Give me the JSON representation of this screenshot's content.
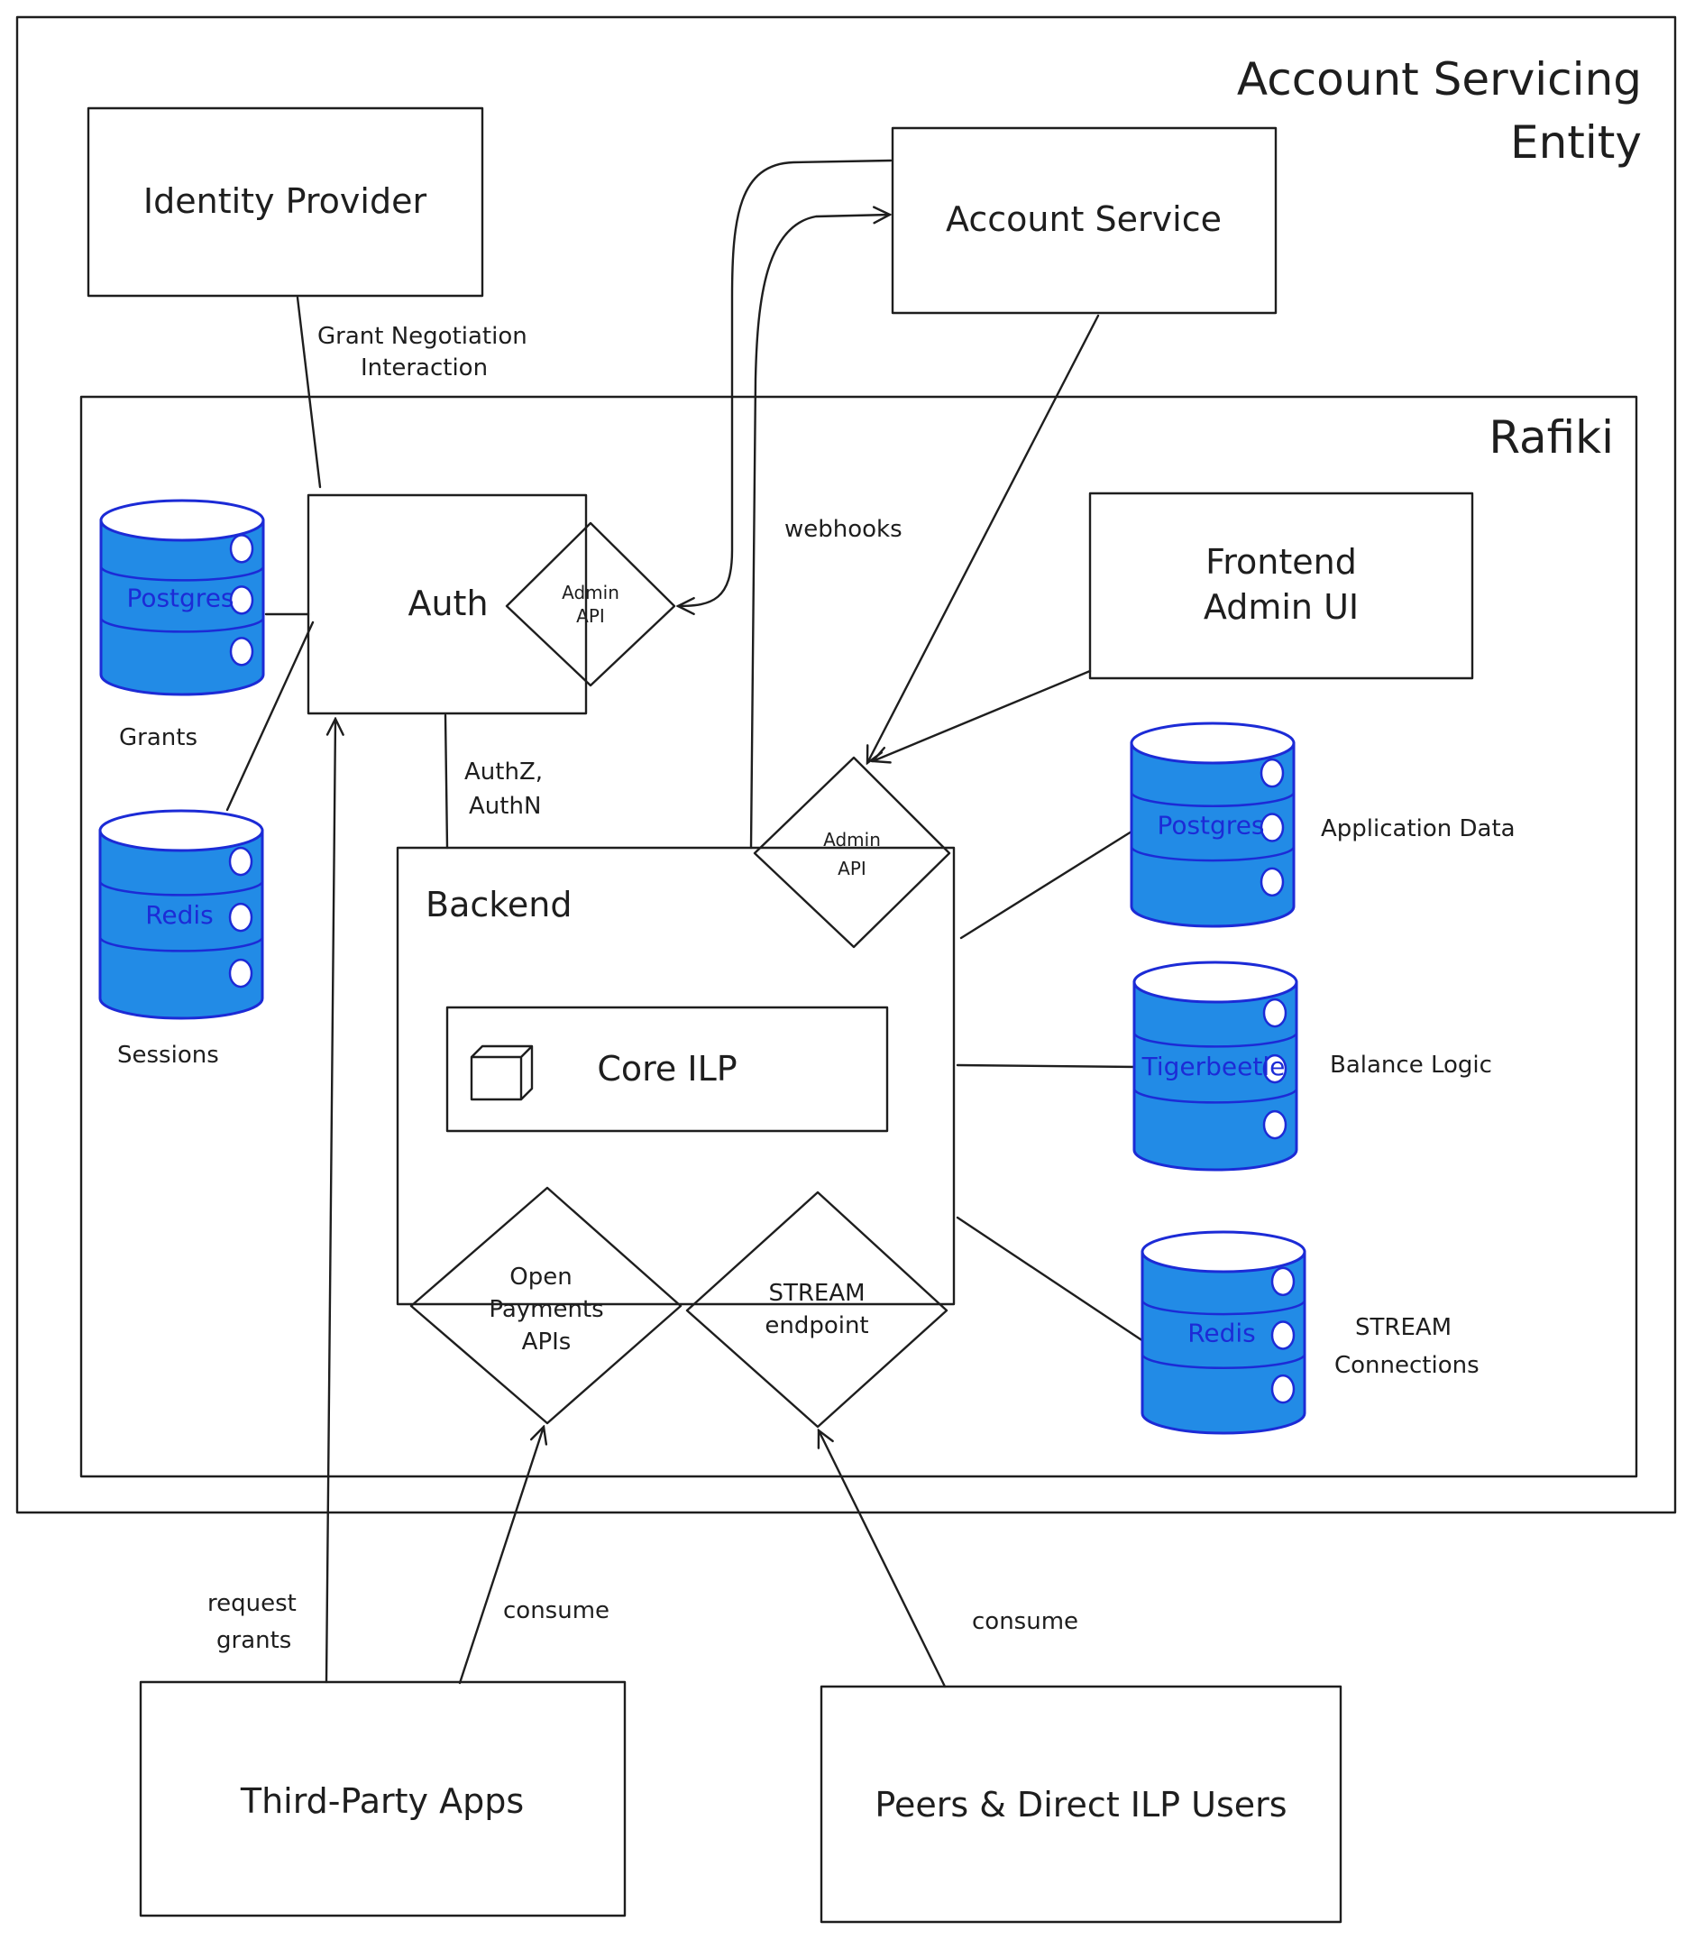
{
  "colors": {
    "rafiki_bg": "#eecbd9",
    "component_fill": "#ced4da",
    "db_fill": "#228be6",
    "db_stroke": "#1c2bd6",
    "db_text": "#1c2bd6",
    "stroke": "#1e1e1e",
    "white": "#ffffff"
  },
  "outer": {
    "title_line1": "Account Servicing",
    "title_line2": "Entity"
  },
  "identity_provider": {
    "label": "Identity Provider"
  },
  "account_service": {
    "label": "Account Service"
  },
  "rafiki": {
    "label": "Rafiki"
  },
  "auth": {
    "label": "Auth",
    "admin_api_line1": "Admin",
    "admin_api_line2": "API"
  },
  "frontend": {
    "line1": "Frontend",
    "line2": "Admin UI"
  },
  "backend": {
    "label": "Backend",
    "core_ilp": "Core ILP",
    "core_icon": "cube-icon",
    "admin_api_line1": "Admin",
    "admin_api_line2": "API",
    "open_payments_line1": "Open",
    "open_payments_line2": "Payments",
    "open_payments_line3": "APIs",
    "stream_line1": "STREAM",
    "stream_line2": "endpoint"
  },
  "databases": {
    "grants": {
      "engine": "Postgres",
      "caption": "Grants"
    },
    "sessions": {
      "engine": "Redis",
      "caption": "Sessions"
    },
    "app_data": {
      "engine": "Postgres",
      "caption": "Application Data"
    },
    "balance": {
      "engine": "Tigerbeetle",
      "caption": "Balance Logic"
    },
    "stream_conn": {
      "engine": "Redis",
      "caption_line1": "STREAM",
      "caption_line2": "Connections"
    }
  },
  "edges": {
    "grant_negotiation_line1": "Grant Negotiation",
    "grant_negotiation_line2": "Interaction",
    "webhooks": "webhooks",
    "authz_line1": "AuthZ,",
    "authz_line2": "AuthN",
    "request_grants_line1": "request",
    "request_grants_line2": "grants",
    "consume_apps": "consume",
    "consume_peers": "consume"
  },
  "third_party": {
    "label": "Third-Party Apps"
  },
  "peers": {
    "label": "Peers & Direct ILP Users"
  }
}
